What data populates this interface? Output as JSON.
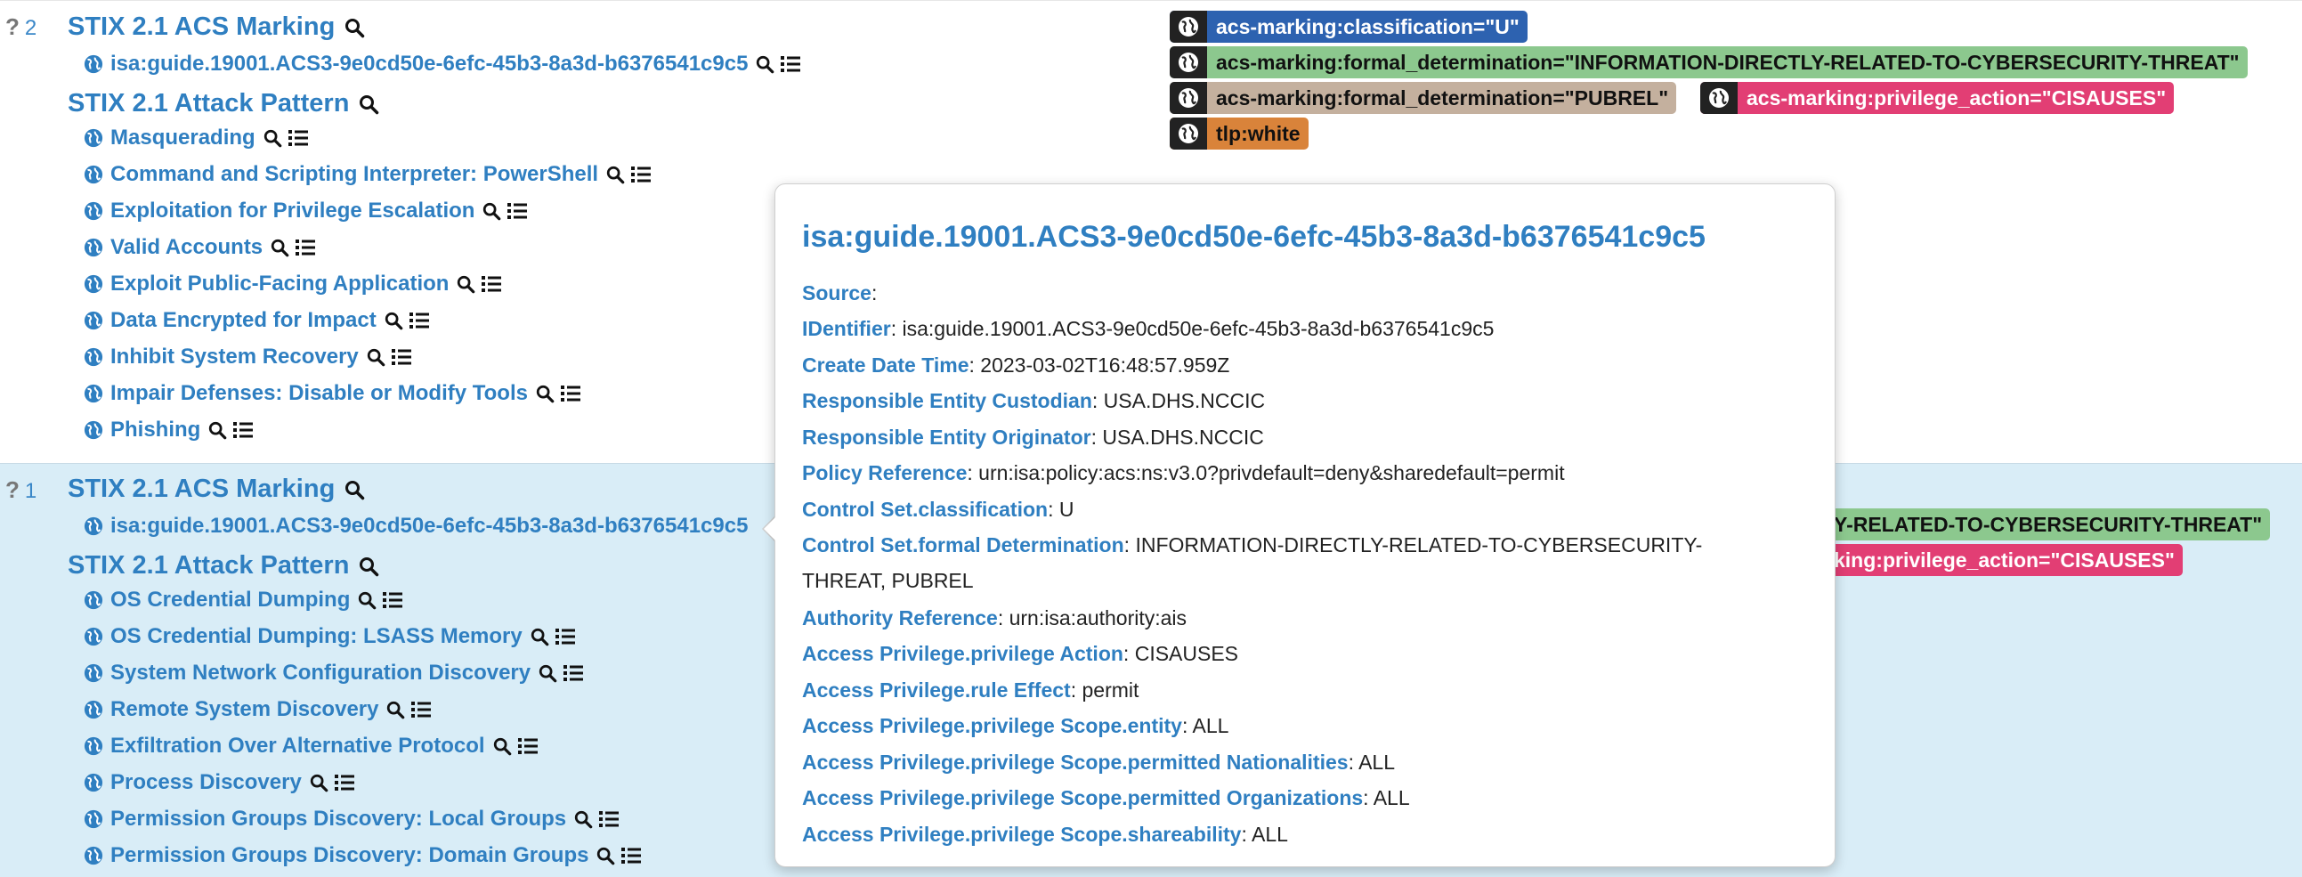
{
  "colors": {
    "link": "#2f7fc1",
    "selected_row_bg": "#d9edf7",
    "tag_icon_bg": "#222222"
  },
  "icons": {
    "globe": "globe-icon",
    "search": "search-icon",
    "list": "list-icon",
    "question": "question-icon"
  },
  "rows": [
    {
      "question_mark": "?",
      "count": "2",
      "acs_title": "STIX 2.1 ACS Marking",
      "acs_item": "isa:guide.19001.ACS3-9e0cd50e-6efc-45b3-8a3d-b6376541c9c5",
      "attack_title": "STIX 2.1 Attack Pattern",
      "attack_items": [
        "Masquerading",
        "Command and Scripting Interpreter: PowerShell",
        "Exploitation for Privilege Escalation",
        "Valid Accounts",
        "Exploit Public-Facing Application",
        "Data Encrypted for Impact",
        "Inhibit System Recovery",
        "Impair Defenses: Disable or Modify Tools",
        "Phishing"
      ],
      "tags": [
        "acs-marking:classification=\"U\"",
        "acs-marking:formal_determination=\"INFORMATION-DIRECTLY-RELATED-TO-CYBERSECURITY-THREAT\"",
        "acs-marking:formal_determination=\"PUBREL\"",
        "acs-marking:privilege_action=\"CISAUSES\"",
        "tlp:white"
      ]
    },
    {
      "question_mark": "?",
      "count": "1",
      "acs_title": "STIX 2.1 ACS Marking",
      "acs_item": "isa:guide.19001.ACS3-9e0cd50e-6efc-45b3-8a3d-b6376541c9c5",
      "attack_title": "STIX 2.1 Attack Pattern",
      "attack_items": [
        "OS Credential Dumping",
        "OS Credential Dumping: LSASS Memory",
        "System Network Configuration Discovery",
        "Remote System Discovery",
        "Exfiltration Over Alternative Protocol",
        "Process Discovery",
        "Permission Groups Discovery: Local Groups",
        "Permission Groups Discovery: Domain Groups"
      ],
      "tags_visible": [
        "Y-RELATED-TO-CYBERSECURITY-THREAT\"",
        "king:privilege_action=\"CISAUSES\""
      ]
    }
  ],
  "popover": {
    "title": "isa:guide.19001.ACS3-9e0cd50e-6efc-45b3-8a3d-b6376541c9c5",
    "fields": [
      {
        "key": "Source",
        "value": ""
      },
      {
        "key": "IDentifier",
        "value": "isa:guide.19001.ACS3-9e0cd50e-6efc-45b3-8a3d-b6376541c9c5"
      },
      {
        "key": "Create Date Time",
        "value": "2023-03-02T16:48:57.959Z"
      },
      {
        "key": "Responsible Entity Custodian",
        "value": "USA.DHS.NCCIC"
      },
      {
        "key": "Responsible Entity Originator",
        "value": "USA.DHS.NCCIC"
      },
      {
        "key": "Policy Reference",
        "value": "urn:isa:policy:acs:ns:v3.0?privdefault=deny&sharedefault=permit"
      },
      {
        "key": "Control Set.classification",
        "value": "U"
      },
      {
        "key": "Control Set.formal Determination",
        "value": "INFORMATION-DIRECTLY-RELATED-TO-CYBERSECURITY-THREAT, PUBREL"
      },
      {
        "key": "Authority Reference",
        "value": "urn:isa:authority:ais"
      },
      {
        "key": "Access Privilege.privilege Action",
        "value": "CISAUSES"
      },
      {
        "key": "Access Privilege.rule Effect",
        "value": "permit"
      },
      {
        "key": "Access Privilege.privilege Scope.entity",
        "value": "ALL"
      },
      {
        "key": "Access Privilege.privilege Scope.permitted Nationalities",
        "value": "ALL"
      },
      {
        "key": "Access Privilege.privilege Scope.permitted Organizations",
        "value": "ALL"
      },
      {
        "key": "Access Privilege.privilege Scope.shareability",
        "value": "ALL"
      }
    ]
  }
}
